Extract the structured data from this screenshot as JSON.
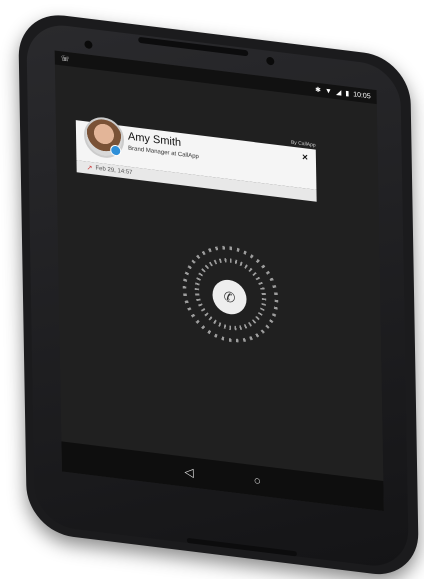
{
  "status_bar": {
    "phone_icon": "phone-icon",
    "bluetooth_icon": "bluetooth-icon",
    "wifi_icon": "wifi-icon",
    "signal_icon": "signal-icon",
    "battery_icon": "battery-icon",
    "time": "10:05"
  },
  "callapp_card": {
    "brand": "By CallApp",
    "name": "Amy Smith",
    "title": "Brand Manager at CallApp",
    "close_glyph": "×",
    "last_call_label": "Feb 29, 14:57",
    "last_call_arrow": "↗"
  },
  "incoming_call": {
    "answer_icon": "phone-icon"
  },
  "nav_bar": {
    "back_glyph": "◁",
    "home_glyph": "○"
  },
  "colors": {
    "screen_bg": "#202020",
    "card_bg": "#f5f5f5",
    "accent_blue": "#2f8fd8",
    "outgoing_red": "#c33333"
  }
}
